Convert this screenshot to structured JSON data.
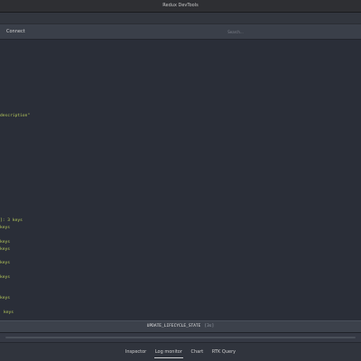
{
  "window": {
    "title": "Redux DevTools"
  },
  "toolbar": {
    "connect_label": "Connect",
    "search_placeholder": "Search..."
  },
  "content": {
    "lines": [
      {
        "text": "description\""
      },
      {
        "text": "]: 3 keys"
      },
      {
        "text": "keys"
      },
      {
        "text": "keys"
      },
      {
        "text": "keys"
      },
      {
        "text": "keys"
      },
      {
        "text": "keys"
      },
      {
        "text": "keys"
      },
      {
        "text": "keys"
      }
    ]
  },
  "action_bar": {
    "action": "UPDATE_LIFECYCLE_STATE",
    "time": "[3s]"
  },
  "tabs": [
    {
      "label": "Inspector",
      "active": false
    },
    {
      "label": "Log monitor",
      "active": true
    },
    {
      "label": "Chart",
      "active": false
    },
    {
      "label": "RTK Query",
      "active": false
    }
  ],
  "colors": {
    "code_text": "#b9cc5c",
    "background": "#2a2e38",
    "toolbar": "#3a3f49"
  }
}
